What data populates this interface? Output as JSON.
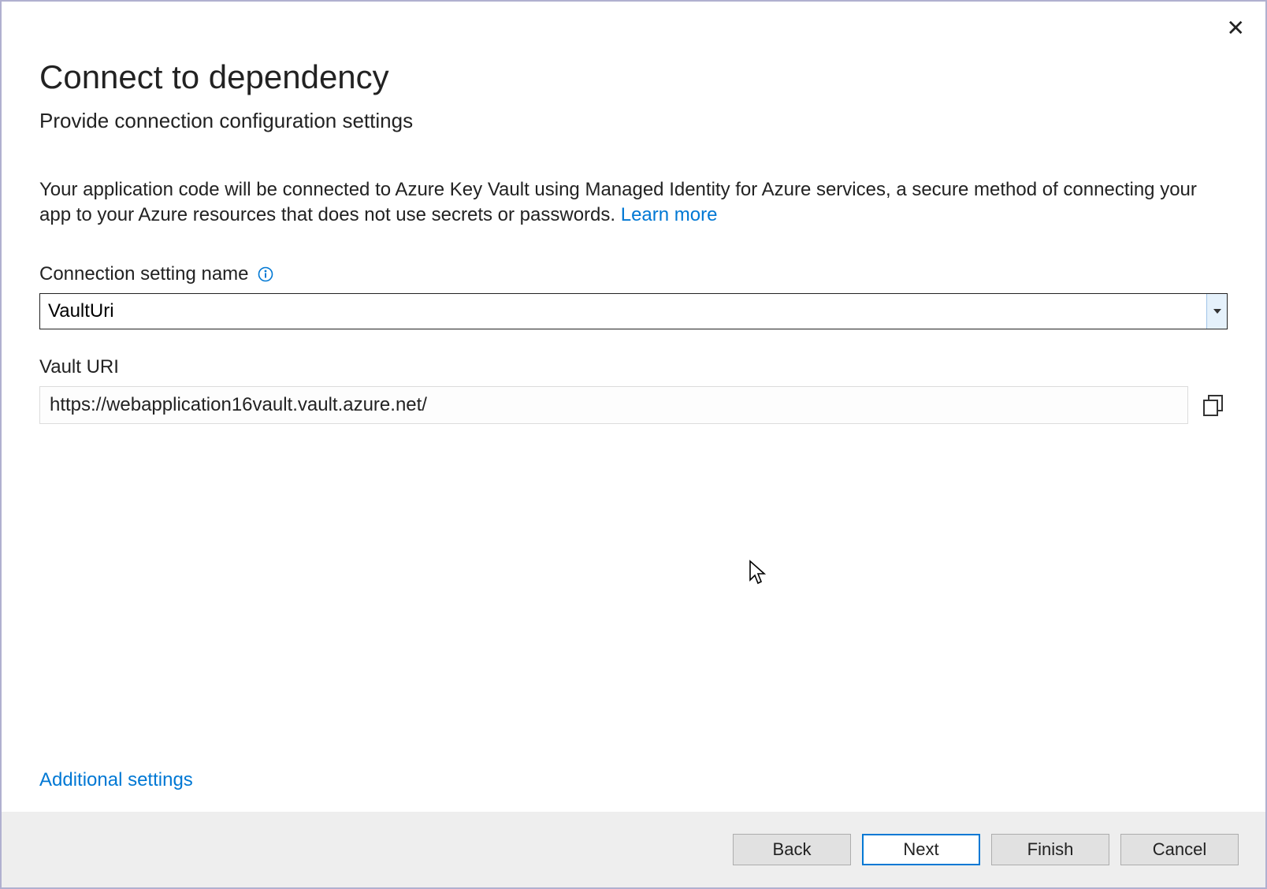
{
  "dialog": {
    "title": "Connect to dependency",
    "subtitle": "Provide connection configuration settings",
    "description_prefix": "Your application code will be connected to Azure Key Vault using Managed Identity for Azure services, a secure method of connecting your app to your Azure resources that does not use secrets or passwords.   ",
    "learn_more": "Learn more"
  },
  "fields": {
    "connection_label": "Connection setting name",
    "connection_value": "VaultUri",
    "vault_uri_label": "Vault URI",
    "vault_uri_value": "https://webapplication16vault.vault.azure.net/"
  },
  "links": {
    "additional": "Additional settings"
  },
  "buttons": {
    "back": "Back",
    "next": "Next",
    "finish": "Finish",
    "cancel": "Cancel"
  }
}
